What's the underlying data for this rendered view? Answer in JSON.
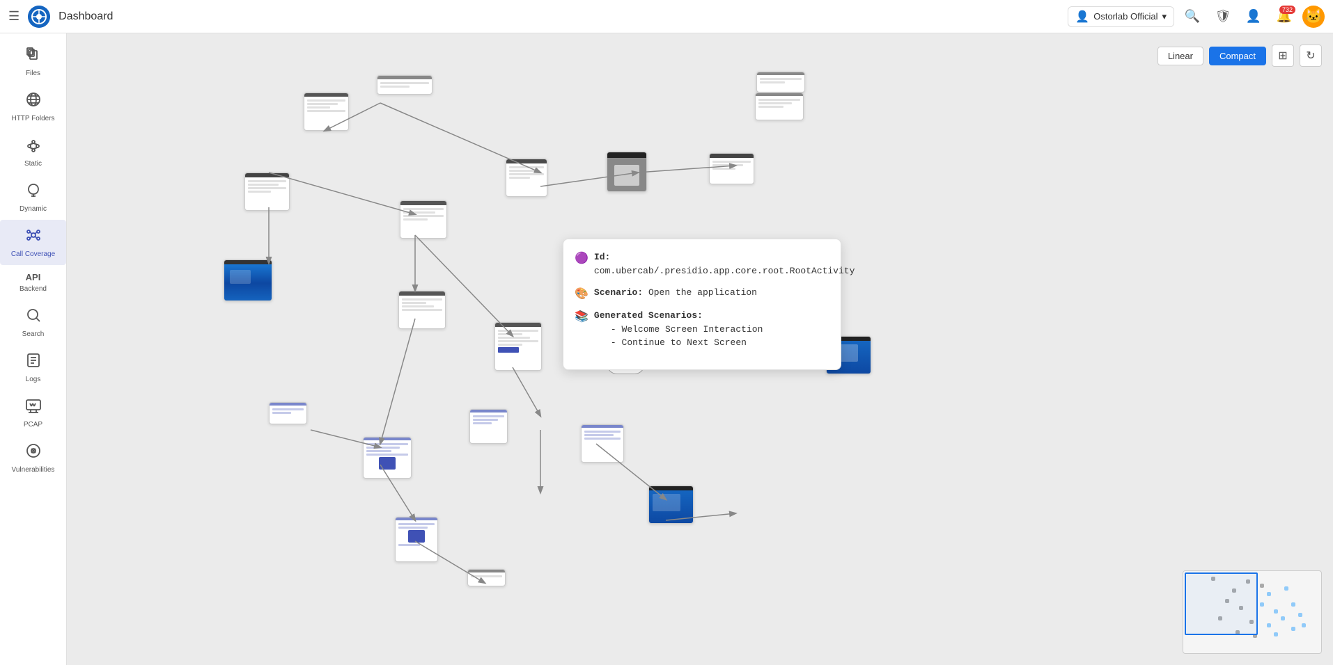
{
  "navbar": {
    "hamburger_icon": "☰",
    "logo_text": "O",
    "title": "Dashboard",
    "org_name": "Ostorlab Official",
    "chevron_icon": "▾",
    "org_icon": "👤",
    "search_icon": "🔍",
    "shield_icon": "🛡",
    "profile_icon": "👤",
    "bell_icon": "🔔",
    "notification_count": "732"
  },
  "sidebar": {
    "items": [
      {
        "id": "files",
        "label": "Files",
        "icon": "📄"
      },
      {
        "id": "http-folders",
        "label": "HTTP Folders",
        "icon": "🌐"
      },
      {
        "id": "static",
        "label": "Static",
        "icon": "✦"
      },
      {
        "id": "dynamic",
        "label": "Dynamic",
        "icon": "⚇"
      },
      {
        "id": "call-coverage",
        "label": "Call Coverage",
        "icon": "⚙",
        "active": true
      },
      {
        "id": "backend",
        "label": "Backend",
        "icon": "API"
      },
      {
        "id": "search",
        "label": "Search",
        "icon": "🔍"
      },
      {
        "id": "logs",
        "label": "Logs",
        "icon": "📋"
      },
      {
        "id": "pcap",
        "label": "PCAP",
        "icon": "🖥"
      },
      {
        "id": "vulnerabilities",
        "label": "Vulnerabilities",
        "icon": "⚙"
      }
    ]
  },
  "canvas": {
    "layout_buttons": [
      {
        "id": "linear",
        "label": "Linear",
        "active": false
      },
      {
        "id": "compact",
        "label": "Compact",
        "active": true
      }
    ],
    "fit_icon": "⊞",
    "refresh_icon": "↻"
  },
  "tooltip": {
    "id_icon": "🟣",
    "id_label": "Id:",
    "id_value": "com.ubercab/.presidio.app.core.root.RootActivity",
    "scenario_icon": "🎨",
    "scenario_label": "Scenario:",
    "scenario_value": "Open the application",
    "generated_icon": "📚",
    "generated_label": "Generated Scenarios:",
    "generated_items": [
      "Welcome Screen Interaction",
      "Continue to Next Screen"
    ]
  }
}
